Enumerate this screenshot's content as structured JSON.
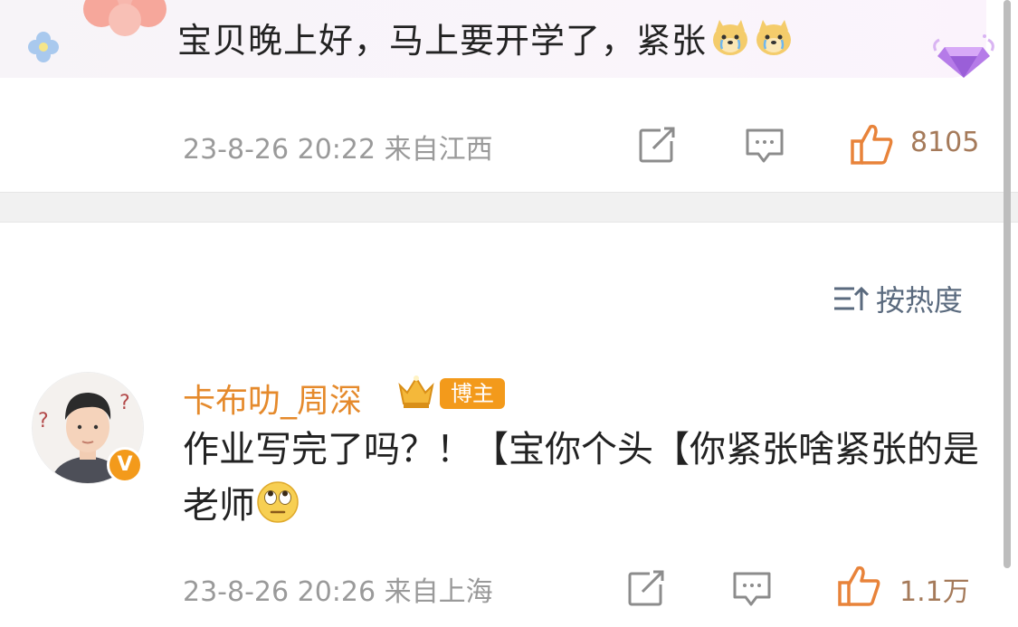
{
  "post": {
    "text": "宝贝晚上好，马上要开学了，紧张",
    "timestamp": "23-8-26 20:22",
    "location": "来自江西",
    "like_count": "8105",
    "emoji": "doge-crying-emoji",
    "badge_icon": "diamond-gem-icon"
  },
  "sort": {
    "label": "按热度",
    "icon": "sort-icon"
  },
  "comment": {
    "username": "卡布叻_周深",
    "badge": "博主",
    "verified_mark": "V",
    "text": "作业写完了吗？！【宝你个头【你紧张啥紧张的是老师",
    "emoji": "eye-roll-emoji",
    "timestamp": "23-8-26 20:26",
    "location": "来自上海",
    "like_count": "1.1万"
  },
  "colors": {
    "username": "#e58a2c",
    "badge_bg": "#f39a1b",
    "meta_text": "#9a9a9a",
    "like_icon": "#e8833a",
    "sort_text": "#5a6a7e"
  }
}
